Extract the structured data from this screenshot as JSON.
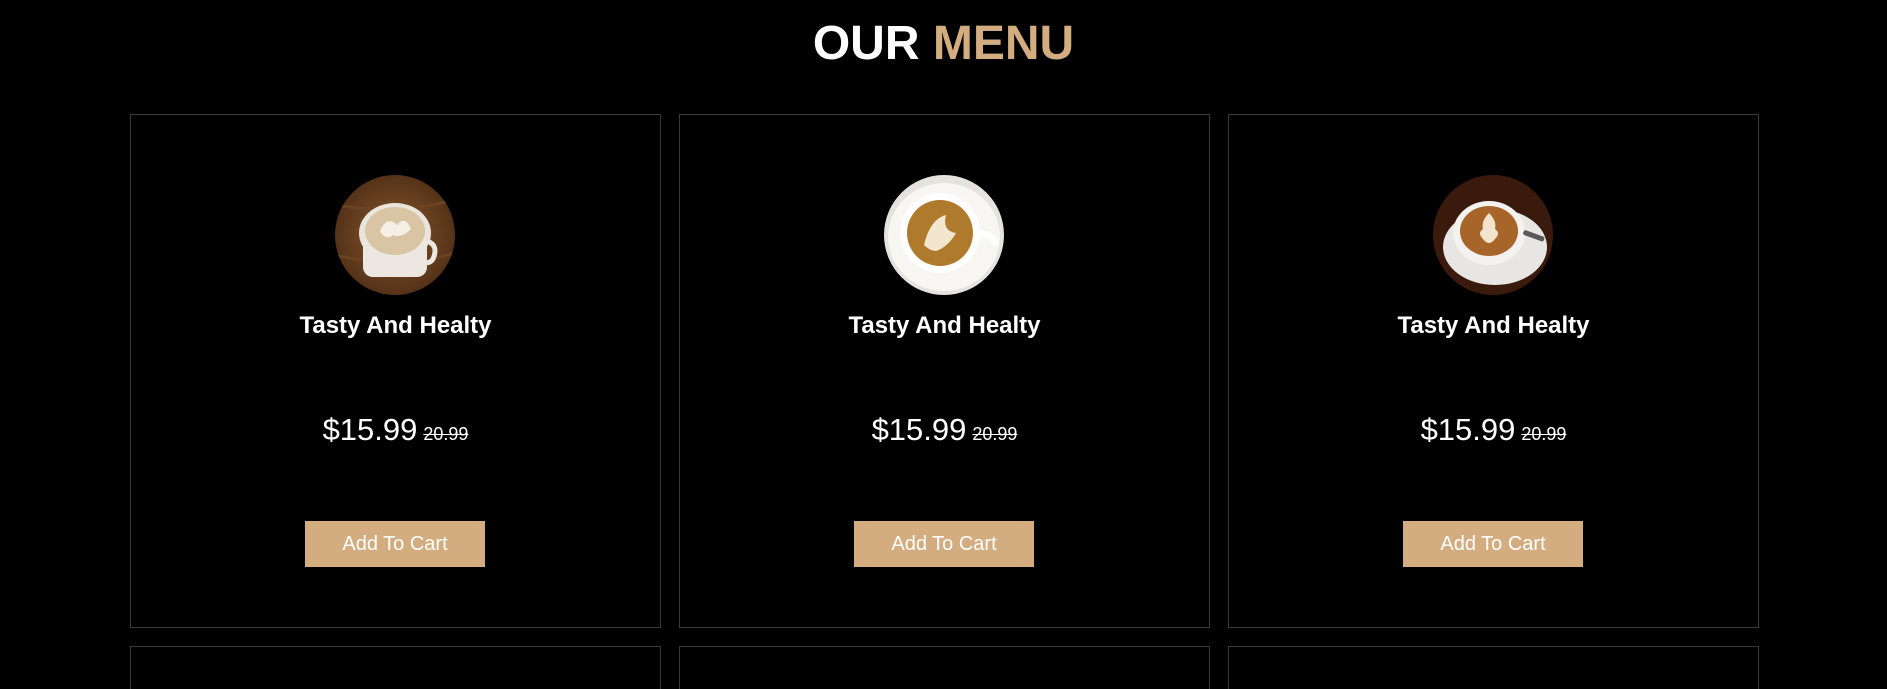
{
  "heading": {
    "part1": "OUR",
    "part2": "MENU"
  },
  "colors": {
    "accent": "#d3ad7f",
    "background": "#000000",
    "card_border": "#3a3a3a"
  },
  "menu": {
    "items": [
      {
        "image": "latte-cup-on-wood-image",
        "title": "Tasty And Healty",
        "price": "$15.99",
        "old_price": "20.99",
        "button": "Add To Cart"
      },
      {
        "image": "cappuccino-top-view-image",
        "title": "Tasty And Healty",
        "price": "$15.99",
        "old_price": "20.99",
        "button": "Add To Cart"
      },
      {
        "image": "latte-art-saucer-image",
        "title": "Tasty And Healty",
        "price": "$15.99",
        "old_price": "20.99",
        "button": "Add To Cart"
      }
    ]
  }
}
